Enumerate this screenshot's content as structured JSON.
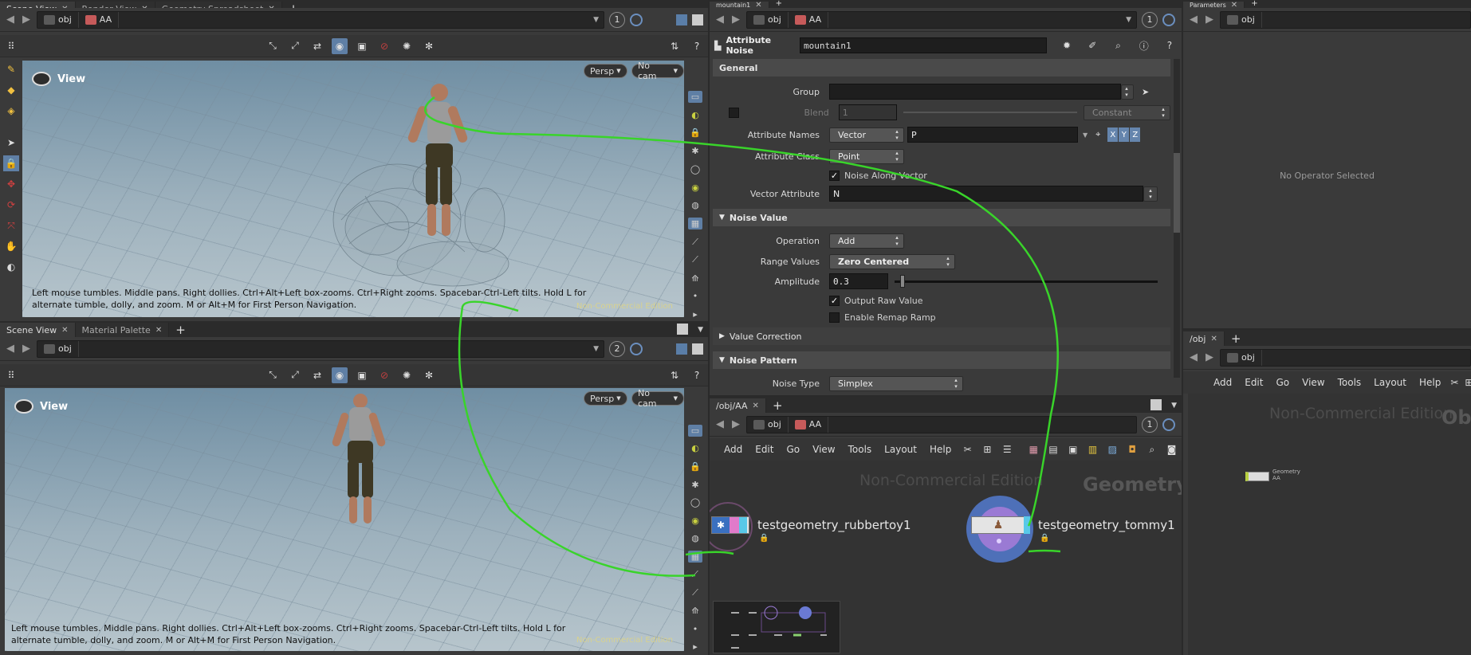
{
  "top_left": {
    "tabs": [
      "Scene View",
      "Render View",
      "Geometry Spreadsheet"
    ],
    "path": [
      "obj",
      "AA"
    ],
    "viewport_number": "1",
    "view_label": "View",
    "persp_button": "Persp",
    "cam_button": "No cam",
    "hint": "Left mouse tumbles. Middle pans. Right dollies. Ctrl+Alt+Left box-zooms. Ctrl+Right zooms. Spacebar-Ctrl-Left tilts. Hold L for alternate tumble, dolly, and zoom. M or Alt+M for First Person Navigation.",
    "watermark": "Non-Commercial Edition"
  },
  "bottom_left": {
    "tabs": [
      "Scene View",
      "Material Palette"
    ],
    "path": [
      "obj"
    ],
    "viewport_number": "2",
    "view_label": "View",
    "persp_button": "Persp",
    "cam_button": "No cam",
    "hint": "Left mouse tumbles. Middle pans. Right dollies. Ctrl+Alt+Left box-zooms. Ctrl+Right zooms. Spacebar-Ctrl-Left tilts. Hold L for alternate tumble, dolly, and zoom. M or Alt+M for First Person Navigation.",
    "watermark": "Non-Commercial Edition"
  },
  "params": {
    "tab": "mountain1",
    "path": [
      "obj",
      "AA"
    ],
    "viewport_number": "1",
    "node_type": "Attribute Noise",
    "node_name": "mountain1",
    "sections": {
      "general": "General",
      "noise_value": "Noise Value",
      "value_correction": "Value Correction",
      "noise_pattern": "Noise Pattern"
    },
    "group_label": "Group",
    "group_value": "",
    "blend_label": "Blend",
    "blend_value": "1",
    "blend_mode": "Constant",
    "attr_names_label": "Attribute Names",
    "attr_names_type": "Vector",
    "attr_names_value": "P",
    "xyz": [
      "X",
      "Y",
      "Z"
    ],
    "attr_class_label": "Attribute Class",
    "attr_class_value": "Point",
    "noise_along_vector": "Noise Along Vector",
    "vector_attr_label": "Vector Attribute",
    "vector_attr_value": "N",
    "operation_label": "Operation",
    "operation_value": "Add",
    "range_label": "Range Values",
    "range_value": "Zero Centered",
    "amplitude_label": "Amplitude",
    "amplitude_value": "0.3",
    "amplitude_fraction": 0.02,
    "output_raw": "Output Raw Value",
    "enable_remap": "Enable Remap Ramp",
    "noise_type_label": "Noise Type",
    "noise_type_value": "Simplex"
  },
  "network": {
    "tab": "/obj/AA",
    "path": [
      "obj",
      "AA"
    ],
    "viewport_number": "1",
    "menu": [
      "Add",
      "Edit",
      "Go",
      "View",
      "Tools",
      "Layout",
      "Help"
    ],
    "watermark": "Non-Commercial Edition",
    "context": "Geometry",
    "nodes": [
      "testgeometry_rubbertoy1",
      "testgeometry_tommy1"
    ]
  },
  "right_top": {
    "tab": "Parameters",
    "path": [
      "obj"
    ],
    "message": "No Operator Selected"
  },
  "right_bottom": {
    "tab": "/obj",
    "path": [
      "obj"
    ],
    "menu": [
      "Add",
      "Edit",
      "Go",
      "View",
      "Tools",
      "Layout",
      "Help"
    ],
    "watermark": "Non-Commercial Edition",
    "context": "Ob",
    "node_type": "Geometry",
    "node_name": "AA"
  },
  "colors": {
    "annotation_stroke": "#39d42a",
    "selection_accent": "#5f7fa5",
    "node_blue": "#5a8fd0"
  }
}
